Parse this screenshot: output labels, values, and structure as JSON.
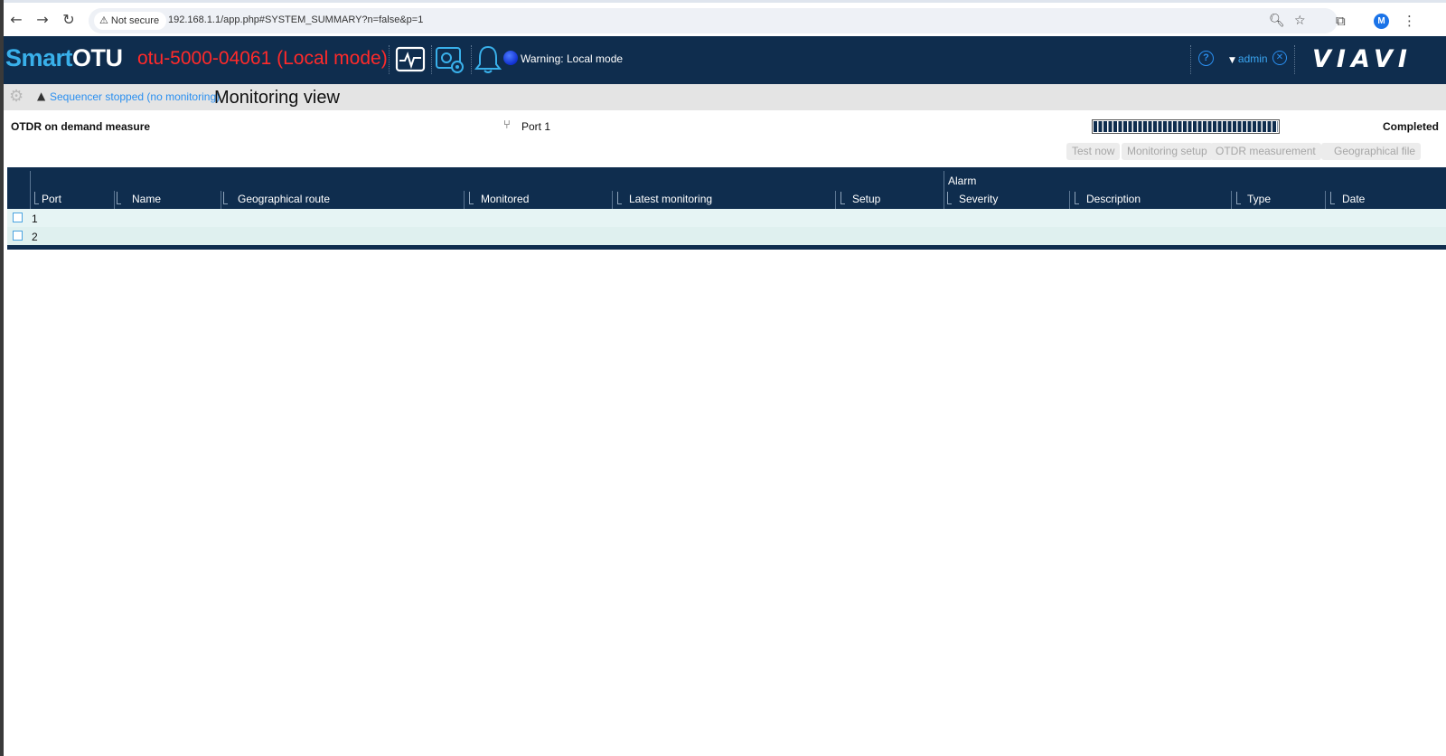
{
  "browser": {
    "not_secure_label": "Not secure",
    "url": "192.168.1.1/app.php#SYSTEM_SUMMARY?n=false&p=1",
    "profile_initial": "M"
  },
  "header": {
    "brand_smart": "Smart",
    "brand_otu": "OTU",
    "device_title": "otu-5000-04061 (Local mode)",
    "warning_label": "Warning:",
    "warning_text": "Local mode",
    "user": "admin",
    "logo": "VIAVI",
    "icons": [
      "monitor-chart-icon",
      "settings-gears-icon",
      "bell-icon"
    ],
    "status_color": "#1030d0"
  },
  "subheader": {
    "sequencer_status": "Sequencer stopped (no monitoring)",
    "page_title": "Monitoring view"
  },
  "measure": {
    "label": "OTDR on demand measure",
    "port": "Port 1",
    "progress_fraction": 1.0,
    "status": "Completed"
  },
  "actions": {
    "test_now": "Test now",
    "monitoring_setup": "Monitoring setup",
    "otdr_measurement": "OTDR measurement",
    "geographical_file": "Geographical file"
  },
  "table": {
    "alarm_group": "Alarm",
    "columns": {
      "port": "Port",
      "name": "Name",
      "route": "Geographical route",
      "monitored": "Monitored",
      "latest": "Latest monitoring",
      "setup": "Setup",
      "severity": "Severity",
      "description": "Description",
      "type": "Type",
      "date": "Date"
    },
    "rows": [
      {
        "port": "1"
      },
      {
        "port": "2"
      }
    ]
  },
  "colors": {
    "header_bg": "#0f2d4e",
    "brand_accent": "#39b0ea",
    "device_title": "#ff2a2a",
    "link": "#2a8ff0"
  }
}
